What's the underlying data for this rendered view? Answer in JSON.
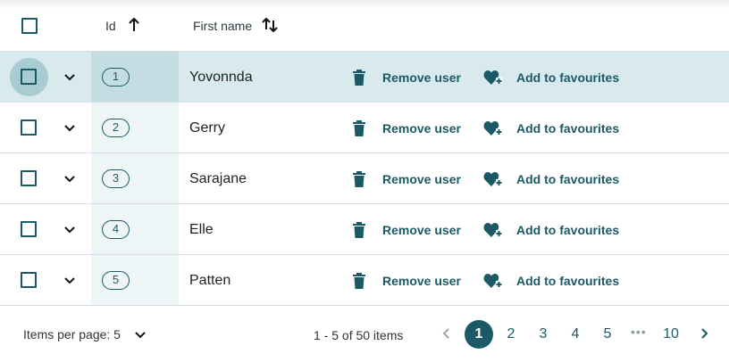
{
  "header": {
    "id_label": "Id",
    "first_name_label": "First name"
  },
  "rows": [
    {
      "id": "1",
      "first_name": "Yovonnda",
      "remove_label": "Remove user",
      "fav_label": "Add to favourites",
      "selected": true
    },
    {
      "id": "2",
      "first_name": "Gerry",
      "remove_label": "Remove user",
      "fav_label": "Add to favourites",
      "selected": false
    },
    {
      "id": "3",
      "first_name": "Sarajane",
      "remove_label": "Remove user",
      "fav_label": "Add to favourites",
      "selected": false
    },
    {
      "id": "4",
      "first_name": "Elle",
      "remove_label": "Remove user",
      "fav_label": "Add to favourites",
      "selected": false
    },
    {
      "id": "5",
      "first_name": "Patten",
      "remove_label": "Remove user",
      "fav_label": "Add to favourites",
      "selected": false
    }
  ],
  "footer": {
    "items_per_page_label": "Items per page: 5",
    "range_label": "1 - 5 of 50 items",
    "pages": [
      "1",
      "2",
      "3",
      "4",
      "5"
    ],
    "ellipsis": "•••",
    "last_page": "10",
    "current_page": "1"
  },
  "icons": {
    "sort_asc": "arrow-up-icon",
    "sort_both": "sort-arrows-icon",
    "expand": "chevron-down-icon",
    "remove": "trash-icon",
    "favourite": "heart-plus-icon",
    "prev": "chevron-left-icon",
    "next": "chevron-right-icon"
  },
  "colors": {
    "accent": "#1b5966",
    "selected_row": "#d8eaee",
    "id_column": "#eef5f6"
  }
}
